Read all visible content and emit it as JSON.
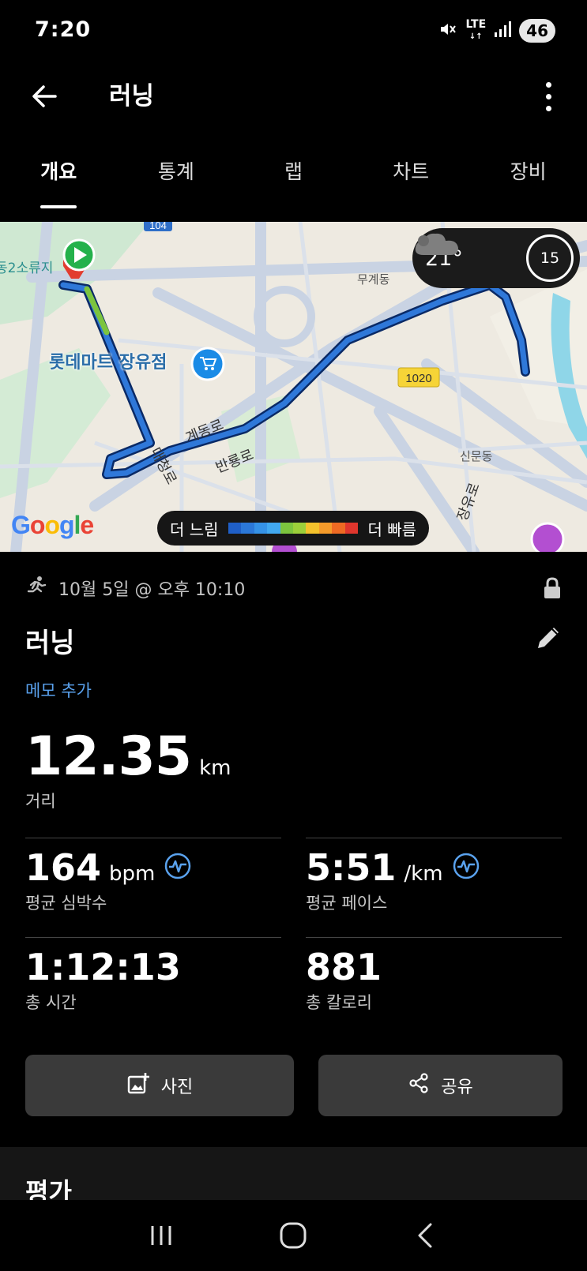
{
  "status_bar": {
    "time": "7:20",
    "network": "LTE",
    "battery": "46",
    "icons": [
      "mute-icon",
      "lte-icon",
      "signal-icon",
      "battery-icon"
    ]
  },
  "app_bar": {
    "title": "러닝",
    "back_icon": "back-arrow-icon",
    "more_icon": "more-vertical-icon"
  },
  "tabs": [
    {
      "label": "개요",
      "active": true
    },
    {
      "label": "통계",
      "active": false
    },
    {
      "label": "랩",
      "active": false
    },
    {
      "label": "차트",
      "active": false
    },
    {
      "label": "장비",
      "active": false
    }
  ],
  "map": {
    "labels": {
      "place_left": "동2소류지",
      "store": "롯데마트 장유점",
      "district_1": "무계동",
      "district_2": "신문동",
      "road_1": "계동로",
      "road_2": "반룡로",
      "road_3": "대청로",
      "road_4": "장유로",
      "route_badge": "1020",
      "route_top": "104"
    },
    "weather": {
      "temperature": "21°",
      "condition_icon": "cloud-icon",
      "ring_value": "15"
    },
    "speed_legend": {
      "slow_label": "더 느림",
      "fast_label": "더 빠름",
      "colors": [
        "#1f5fc7",
        "#2b78d8",
        "#3592e6",
        "#42a9f0",
        "#7cc43e",
        "#9ccf3a",
        "#f4c22c",
        "#f59b2a",
        "#ef6a23",
        "#e0362d"
      ]
    },
    "google_logo": "Google"
  },
  "summary": {
    "date": "10월 5일 @ 오후 10:10",
    "activity_icon": "running-icon",
    "lock_icon": "lock-icon",
    "activity_name": "러닝",
    "edit_icon": "pencil-icon",
    "memo_link": "메모 추가",
    "distance": {
      "value": "12.35",
      "unit": "km",
      "label": "거리"
    }
  },
  "stats": [
    {
      "value": "164",
      "unit": "bpm",
      "label": "평균 심박수",
      "icon": "heart-rate-icon"
    },
    {
      "value": "5:51",
      "unit": "/km",
      "label": "평균 페이스",
      "icon": "heart-rate-icon"
    },
    {
      "value": "1:12:13",
      "unit": "",
      "label": "총 시간",
      "icon": ""
    },
    {
      "value": "881",
      "unit": "",
      "label": "총 칼로리",
      "icon": ""
    }
  ],
  "actions": {
    "photo_label": "사진",
    "photo_icon": "add-photo-icon",
    "share_label": "공유",
    "share_icon": "share-icon"
  },
  "rating": {
    "title": "평가"
  },
  "nav_bar": {
    "icons": [
      "recent-apps-icon",
      "home-icon",
      "back-icon"
    ]
  }
}
